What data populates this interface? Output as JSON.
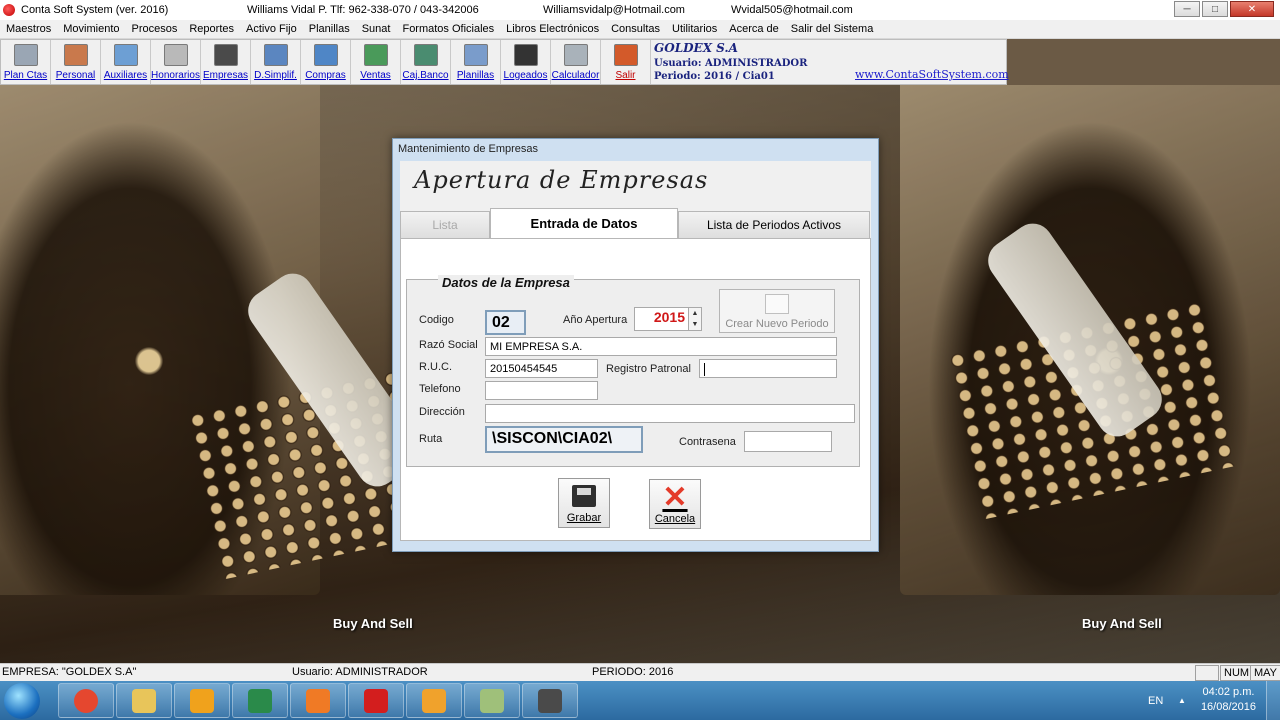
{
  "title_bar": {
    "app_title": "Conta Soft System (ver. 2016)",
    "author": "Williams Vidal P. Tlf: 962-338-070 / 043-342006",
    "email1": "Williamsvidalp@Hotmail.com",
    "email2": "Wvidal505@hotmail.com",
    "minimize": "─",
    "maximize": "□",
    "close": "✕"
  },
  "menu": [
    "Maestros",
    "Movimiento",
    "Procesos",
    "Reportes",
    "Activo Fijo",
    "Planillas",
    "Sunat",
    "Formatos Oficiales",
    "Libros Electrónicos",
    "Consultas",
    "Utilitarios",
    "Acerca de",
    "Salir del Sistema"
  ],
  "toolbar": [
    {
      "label": "Plan Ctas",
      "icon": "plan-cuentas-icon",
      "color": "#9aa6b4"
    },
    {
      "label": "Personal",
      "icon": "personal-icon",
      "color": "#c9794c"
    },
    {
      "label": "Auxiliares",
      "icon": "auxiliares-icon",
      "color": "#6d9fd4"
    },
    {
      "label": "Honorarios",
      "icon": "honorarios-icon",
      "color": "#b9b9b9"
    },
    {
      "label": "Empresas",
      "icon": "empresas-icon",
      "color": "#4a4a4a"
    },
    {
      "label": "D.Simplif.",
      "icon": "diario-simplificado-icon",
      "color": "#5b86c0"
    },
    {
      "label": "Compras",
      "icon": "compras-icon",
      "color": "#4f86c6"
    },
    {
      "label": "Ventas",
      "icon": "ventas-icon",
      "color": "#4a9a5a"
    },
    {
      "label": "Caj.Banco",
      "icon": "caja-banco-icon",
      "color": "#4a8c70"
    },
    {
      "label": "Planillas",
      "icon": "planillas-icon",
      "color": "#7a9ccb"
    },
    {
      "label": "Logeados",
      "icon": "logeados-icon",
      "color": "#333333"
    },
    {
      "label": "Calculador",
      "icon": "calculadora-icon",
      "color": "#a9b2ba"
    },
    {
      "label": "Salir",
      "icon": "salir-icon",
      "color": "#d35a2a"
    }
  ],
  "company": {
    "name": "GOLDEX S.A",
    "usuario": "Usuario: ADMINISTRADOR",
    "periodo": "Periodo: 2016  /  Cia01",
    "website": "www.ContaSoftSystem.com"
  },
  "wallpaper_text": "Buy And Sell",
  "dialog": {
    "window_title": "Mantenimiento de Empresas",
    "heading": "Apertura de Empresas",
    "tabs": [
      "Lista",
      "Entrada de Datos",
      "Lista de Periodos Activos"
    ],
    "section": "Datos de la Empresa",
    "fields": {
      "codigo_label": "Codigo",
      "codigo_value": "02",
      "anio_label": "Año Apertura",
      "anio_value": "2015",
      "crear_button": "Crear Nuevo Periodo",
      "razon_label": "Razó Social",
      "razon_value": "MI EMPRESA S.A.",
      "ruc_label": "R.U.C.",
      "ruc_value": "20150454545",
      "registro_label": "Registro Patronal",
      "registro_value": "",
      "telefono_label": "Telefono",
      "telefono_value": "",
      "direccion_label": "Dirección",
      "direccion_value": "",
      "ruta_label": "Ruta",
      "ruta_value": "\\SISCON\\CIA02\\",
      "contrasena_label": "Contrasena",
      "contrasena_value": ""
    },
    "grabar": "Grabar",
    "cancela": "Cancela"
  },
  "status_bar": {
    "empresa": "EMPRESA: \"GOLDEX S.A\"",
    "usuario": "Usuario: ADMINISTRADOR",
    "periodo": "PERIODO: 2016",
    "num": "NUM",
    "may": "MAY"
  },
  "taskbar": {
    "apps": [
      {
        "icon": "chrome-icon",
        "color": "#e5472f"
      },
      {
        "icon": "file-explorer-icon",
        "color": "#e8c55a"
      },
      {
        "icon": "outlook-icon",
        "color": "#f0a21c"
      },
      {
        "icon": "excel-icon",
        "color": "#2a8a4a"
      },
      {
        "icon": "media-player-icon",
        "color": "#f07a25"
      },
      {
        "icon": "apple-app-icon",
        "color": "#d31e1e"
      },
      {
        "icon": "star-app-icon",
        "color": "#f0a22c"
      },
      {
        "icon": "notes-app-icon",
        "color": "#9fc07a"
      },
      {
        "icon": "camera-app-icon",
        "color": "#4a4a4a"
      }
    ],
    "language": "EN",
    "tray_arrow": "▲",
    "time": "04:02 p.m.",
    "date": "16/08/2016"
  }
}
